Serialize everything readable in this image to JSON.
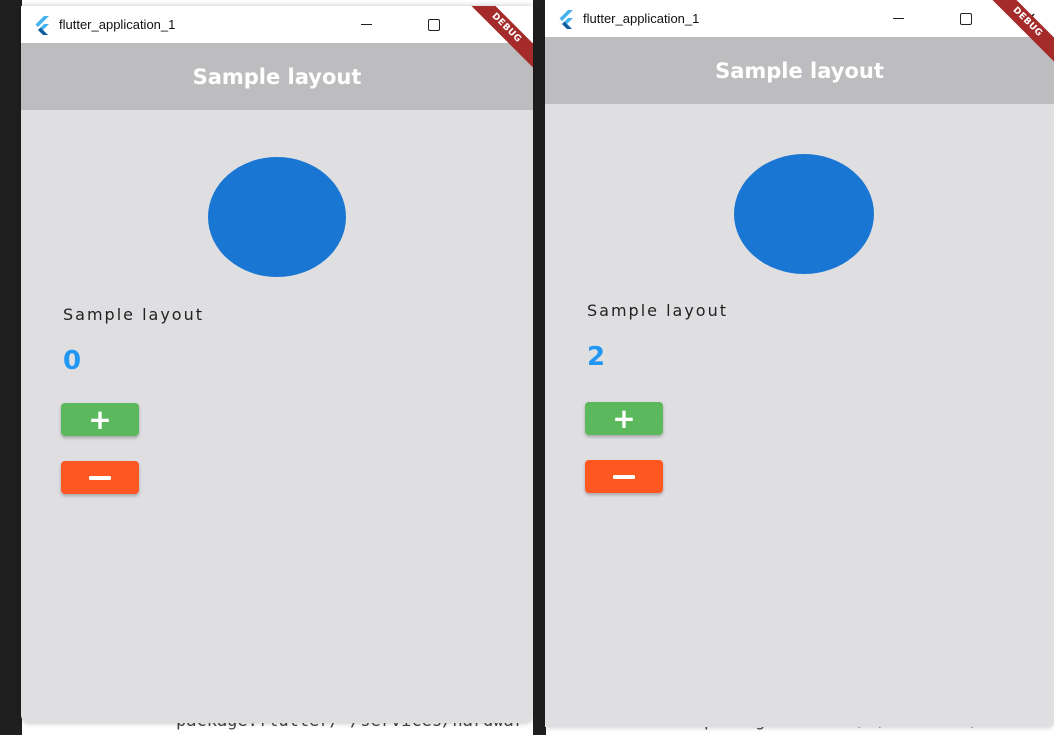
{
  "windows": [
    {
      "title": "flutter_application_1",
      "appbar_title": "Sample layout",
      "debug_label": "DEBUG",
      "label": "Sample layout",
      "counter": "0",
      "plus_label": "+",
      "minus_label": "−"
    },
    {
      "title": "flutter_application_1",
      "appbar_title": "Sample layout",
      "debug_label": "DEBUG",
      "label": "Sample layout",
      "counter": "2",
      "plus_label": "+",
      "minus_label": "−"
    }
  ],
  "controls": {
    "minimize": "—",
    "maximize": "☐",
    "close": "✕"
  },
  "ide": {
    "bottom_text_left": "package:flutter/ /services/hardwar",
    "bottom_text_right": "package:flutter/ /services/hardwa"
  },
  "colors": {
    "appbar": "#bdbdbf",
    "background": "#dfdfe2",
    "avatar": "#1976d2",
    "counter": "#2196f3",
    "plus_button": "#5cb85c",
    "minus_button": "#ff5722",
    "debug_banner": "#a52b2b"
  },
  "icons": {
    "window_logo": "flutter-logo-icon",
    "minimize": "minimize-icon",
    "maximize": "maximize-icon",
    "close": "close-icon"
  }
}
